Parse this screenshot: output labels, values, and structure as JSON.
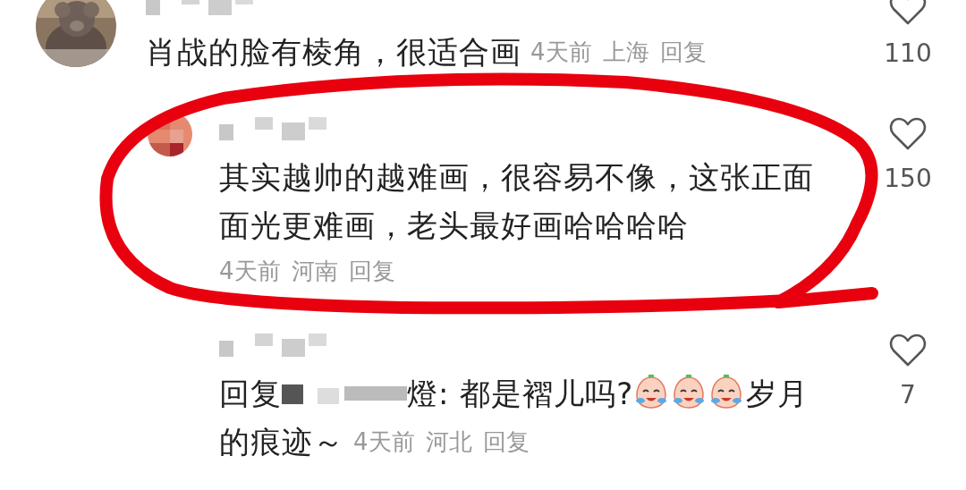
{
  "comments": [
    {
      "kind": "top",
      "segments": [
        {
          "kind": "text",
          "text": "肖战的脸有棱角，很适合画"
        }
      ],
      "meta_below": false,
      "time": "4天前",
      "location": "上海",
      "reply": "回复",
      "likes": "110"
    },
    {
      "kind": "reply",
      "avatar": {
        "kind": "mosaic"
      },
      "segments": [
        {
          "kind": "text",
          "text": "其实越帅的越难画，很容易不像，这张正面面光更难画，老头最好画哈哈哈哈"
        }
      ],
      "meta_below": true,
      "time": "4天前",
      "location": "河南",
      "reply": "回复",
      "likes": "150"
    },
    {
      "kind": "reply",
      "segments": [
        {
          "kind": "text",
          "text": "回复"
        },
        {
          "kind": "mosaic"
        },
        {
          "kind": "text",
          "text": "燈: 都是褶儿吗?"
        },
        {
          "kind": "emoji"
        },
        {
          "kind": "emoji"
        },
        {
          "kind": "emoji"
        },
        {
          "kind": "text",
          "text": "岁月的痕迹～"
        }
      ],
      "meta_below": false,
      "time": "4天前",
      "location": "河北",
      "reply": "回复",
      "likes": "7"
    }
  ]
}
